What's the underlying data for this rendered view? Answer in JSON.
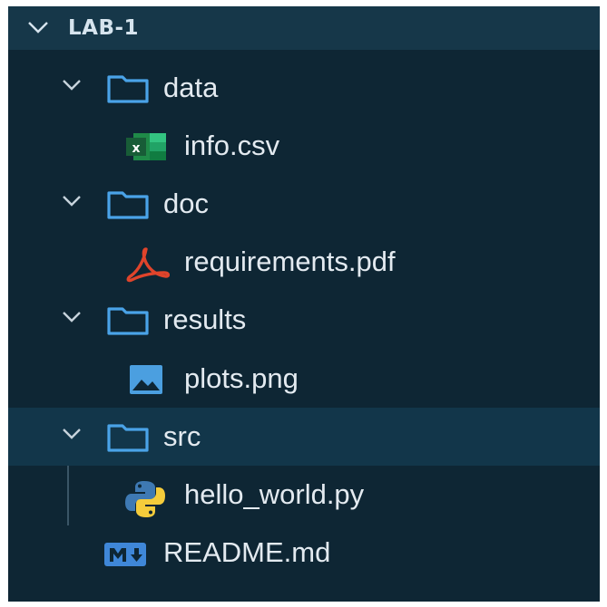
{
  "explorer": {
    "root": {
      "label": "LAB-1",
      "icon": "chevron-down-icon"
    },
    "items": [
      {
        "label": "data",
        "type": "folder",
        "icon": "folder-icon",
        "expanded": true
      },
      {
        "label": "info.csv",
        "type": "file",
        "icon": "excel-icon"
      },
      {
        "label": "doc",
        "type": "folder",
        "icon": "folder-icon",
        "expanded": true
      },
      {
        "label": "requirements.pdf",
        "type": "file",
        "icon": "pdf-icon"
      },
      {
        "label": "results",
        "type": "folder",
        "icon": "folder-icon",
        "expanded": true
      },
      {
        "label": "plots.png",
        "type": "file",
        "icon": "image-icon"
      },
      {
        "label": "src",
        "type": "folder",
        "icon": "folder-icon",
        "expanded": true,
        "selected": true
      },
      {
        "label": "hello_world.py",
        "type": "file",
        "icon": "python-icon"
      },
      {
        "label": "README.md",
        "type": "file",
        "icon": "markdown-icon"
      }
    ]
  },
  "colors": {
    "background": "#0e2634",
    "header": "#163749",
    "selected_row": "#12364a",
    "folder_outline": "#4aa3e8",
    "excel_green": "#1f8a48",
    "pdf_red": "#e0442b",
    "image_blue": "#4b9fe0",
    "python_blue": "#3e79b3",
    "python_yellow": "#f5cc3b",
    "markdown_blue": "#3f87d8"
  }
}
